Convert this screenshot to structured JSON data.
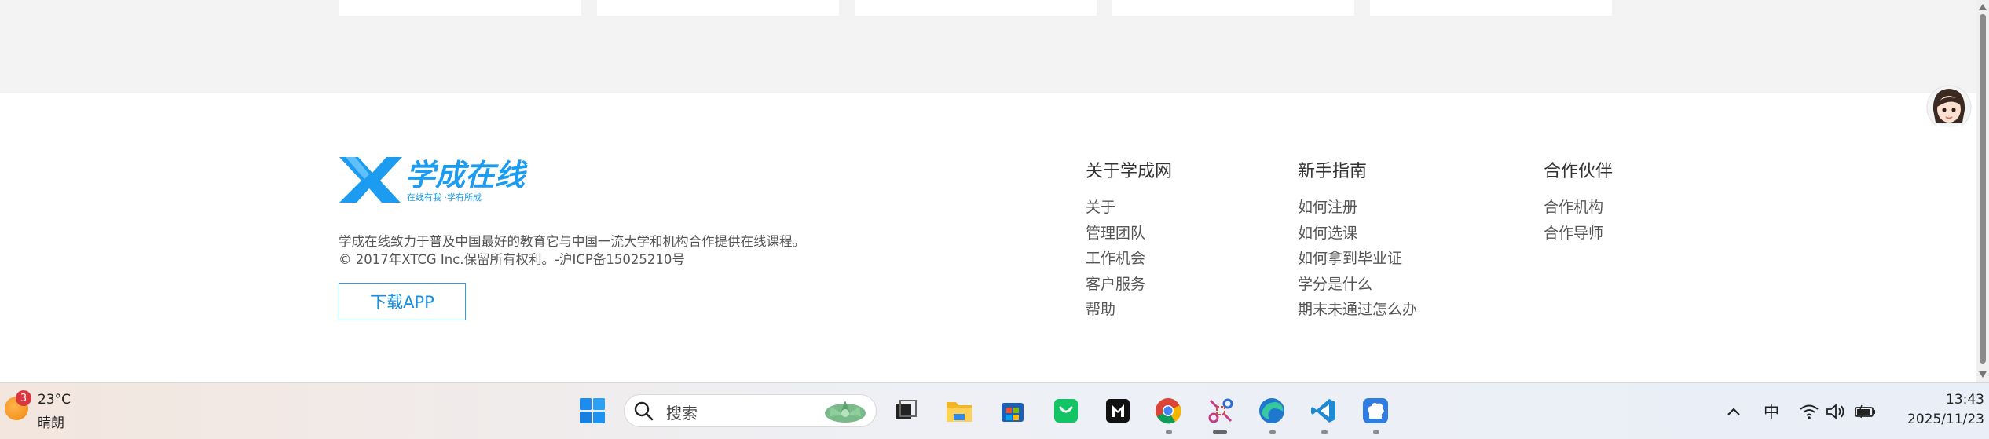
{
  "brand": {
    "logo_text": "学成在线",
    "logo_sub": "在线有我 ·学有所成"
  },
  "footer": {
    "description": "学成在线致力于普及中国最好的教育它与中国一流大学和机构合作提供在线课程。",
    "copyright": "© 2017年XTCG Inc.保留所有权利。-沪ICP备15025210号",
    "app_button": "下载APP",
    "columns": [
      {
        "title": "关于学成网",
        "items": [
          "关于",
          "管理团队",
          "工作机会",
          "客户服务",
          "帮助"
        ]
      },
      {
        "title": "新手指南",
        "items": [
          "如何注册",
          "如何选课",
          "如何拿到毕业证",
          "学分是什么",
          "期末未通过怎么办"
        ]
      },
      {
        "title": "合作伙伴",
        "items": [
          "合作机构",
          "合作导师"
        ]
      }
    ]
  },
  "taskbar": {
    "weather": {
      "badge": "3",
      "temp": "23°C",
      "condition": "晴朗"
    },
    "search_placeholder": "搜索",
    "apps": [
      "windows-start",
      "task-view",
      "file-explorer",
      "microsoft-store",
      "wechat-pay",
      "jetbrains",
      "chrome",
      "snipping-tool",
      "edge",
      "vscode",
      "app-chef"
    ],
    "ime": "中",
    "time": "13:43",
    "date": "2025/11/23"
  },
  "colors": {
    "brand_blue": "#1b9cf0",
    "button_border": "#2d9ce6",
    "page_gray": "#f3f3f3"
  }
}
